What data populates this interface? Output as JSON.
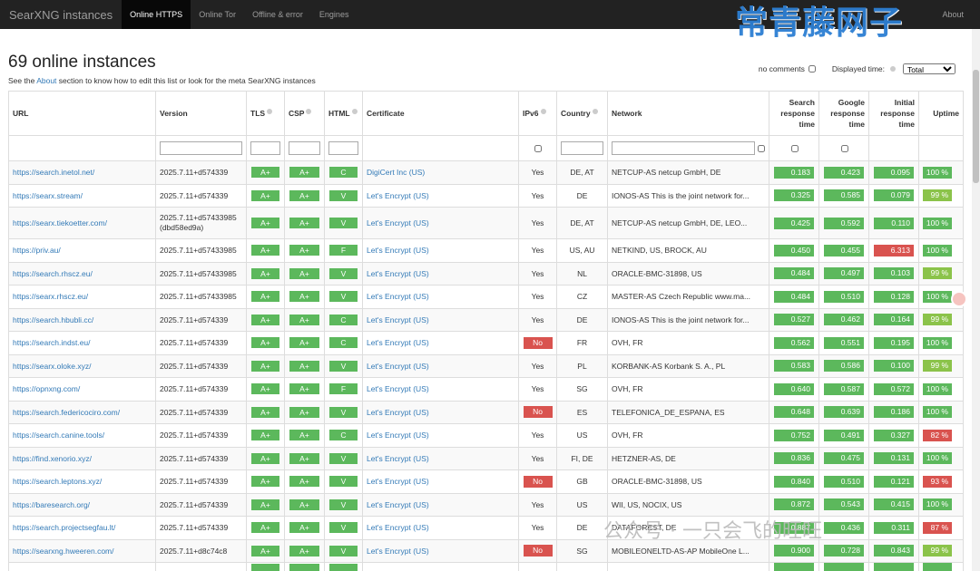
{
  "nav": {
    "brand": "SearXNG instances",
    "items": [
      "Online HTTPS",
      "Online Tor",
      "Offline & error",
      "Engines"
    ],
    "active": 0,
    "about": "About"
  },
  "watermark_top": "常青藤网子",
  "watermark_bottom": "公众号 · 一只会飞的旺旺",
  "controls": {
    "comments_label": "no comments",
    "displayed_time_label": "Displayed time:",
    "displayed_time_value": "Total"
  },
  "page": {
    "title": "69 online instances",
    "subtitle_prefix": "See the ",
    "subtitle_link": "About",
    "subtitle_suffix": " section to know how to edit this list or look for the meta SearXNG instances"
  },
  "columns": {
    "url": "URL",
    "version": "Version",
    "tls": "TLS",
    "csp": "CSP",
    "html": "HTML",
    "certificate": "Certificate",
    "ipv6": "IPv6",
    "country": "Country",
    "network": "Network",
    "search": [
      "Search",
      "response",
      "time"
    ],
    "google": [
      "Google",
      "response",
      "time"
    ],
    "initial": [
      "Initial",
      "response",
      "time"
    ],
    "uptime": "Uptime"
  },
  "rows": [
    {
      "url": "https://search.inetol.net/",
      "version": "2025.7.11+d574339",
      "tls": "A+",
      "csp": "A+",
      "html": "C",
      "cert": "DigiCert Inc (US)",
      "ipv6": "Yes",
      "country": "DE, AT",
      "network": "NETCUP-AS netcup GmbH, DE",
      "search": "0.183",
      "google": "0.423",
      "initial": "0.095",
      "initial_bad": false,
      "uptime": "100 %",
      "uptime_state": "ok"
    },
    {
      "url": "https://searx.stream/",
      "version": "2025.7.11+d574339",
      "tls": "A+",
      "csp": "A+",
      "html": "V",
      "cert": "Let's Encrypt (US)",
      "ipv6": "Yes",
      "country": "DE",
      "network": "IONOS-AS This is the joint network for...",
      "search": "0.325",
      "google": "0.585",
      "initial": "0.079",
      "initial_bad": false,
      "uptime": "99 %",
      "uptime_state": "warn"
    },
    {
      "url": "https://searx.tiekoetter.com/",
      "version": "2025.7.11+d57433985",
      "version2": "(dbd58ed9a)",
      "tls": "A+",
      "csp": "A+",
      "html": "V",
      "cert": "Let's Encrypt (US)",
      "ipv6": "Yes",
      "country": "DE, AT",
      "network": "NETCUP-AS netcup GmbH, DE, LEO...",
      "search": "0.425",
      "google": "0.592",
      "initial": "0.110",
      "initial_bad": false,
      "uptime": "100 %",
      "uptime_state": "ok"
    },
    {
      "url": "https://priv.au/",
      "version": "2025.7.11+d57433985",
      "tls": "A+",
      "csp": "A+",
      "html": "F",
      "cert": "Let's Encrypt (US)",
      "ipv6": "Yes",
      "country": "US, AU",
      "network": "NETKIND, US, BROCK, AU",
      "search": "0.450",
      "google": "0.455",
      "initial": "6.313",
      "initial_bad": true,
      "uptime": "100 %",
      "uptime_state": "ok"
    },
    {
      "url": "https://search.rhscz.eu/",
      "version": "2025.7.11+d57433985",
      "tls": "A+",
      "csp": "A+",
      "html": "V",
      "cert": "Let's Encrypt (US)",
      "ipv6": "Yes",
      "country": "NL",
      "network": "ORACLE-BMC-31898, US",
      "search": "0.484",
      "google": "0.497",
      "initial": "0.103",
      "initial_bad": false,
      "uptime": "99 %",
      "uptime_state": "warn"
    },
    {
      "url": "https://searx.rhscz.eu/",
      "version": "2025.7.11+d57433985",
      "tls": "A+",
      "csp": "A+",
      "html": "V",
      "cert": "Let's Encrypt (US)",
      "ipv6": "Yes",
      "country": "CZ",
      "network": "MASTER-AS Czech Republic www.ma...",
      "search": "0.484",
      "google": "0.510",
      "initial": "0.128",
      "initial_bad": false,
      "uptime": "100 %",
      "uptime_state": "ok"
    },
    {
      "url": "https://search.hbubli.cc/",
      "version": "2025.7.11+d574339",
      "tls": "A+",
      "csp": "A+",
      "html": "C",
      "cert": "Let's Encrypt (US)",
      "ipv6": "Yes",
      "country": "DE",
      "network": "IONOS-AS This is the joint network for...",
      "search": "0.527",
      "google": "0.462",
      "initial": "0.164",
      "initial_bad": false,
      "uptime": "99 %",
      "uptime_state": "warn"
    },
    {
      "url": "https://search.indst.eu/",
      "version": "2025.7.11+d574339",
      "tls": "A+",
      "csp": "A+",
      "html": "C",
      "cert": "Let's Encrypt (US)",
      "ipv6": "No",
      "country": "FR",
      "network": "OVH, FR",
      "search": "0.562",
      "google": "0.551",
      "initial": "0.195",
      "initial_bad": false,
      "uptime": "100 %",
      "uptime_state": "ok"
    },
    {
      "url": "https://searx.oloke.xyz/",
      "version": "2025.7.11+d574339",
      "tls": "A+",
      "csp": "A+",
      "html": "V",
      "cert": "Let's Encrypt (US)",
      "ipv6": "Yes",
      "country": "PL",
      "network": "KORBANK-AS Korbank S. A., PL",
      "search": "0.583",
      "google": "0.586",
      "initial": "0.100",
      "initial_bad": false,
      "uptime": "99 %",
      "uptime_state": "warn"
    },
    {
      "url": "https://opnxng.com/",
      "version": "2025.7.11+d574339",
      "tls": "A+",
      "csp": "A+",
      "html": "F",
      "cert": "Let's Encrypt (US)",
      "ipv6": "Yes",
      "country": "SG",
      "network": "OVH, FR",
      "search": "0.640",
      "google": "0.587",
      "initial": "0.572",
      "initial_bad": false,
      "uptime": "100 %",
      "uptime_state": "ok"
    },
    {
      "url": "https://search.federicociro.com/",
      "version": "2025.7.11+d574339",
      "tls": "A+",
      "csp": "A+",
      "html": "V",
      "cert": "Let's Encrypt (US)",
      "ipv6": "No",
      "country": "ES",
      "network": "TELEFONICA_DE_ESPANA, ES",
      "search": "0.648",
      "google": "0.639",
      "initial": "0.186",
      "initial_bad": false,
      "uptime": "100 %",
      "uptime_state": "ok"
    },
    {
      "url": "https://search.canine.tools/",
      "version": "2025.7.11+d574339",
      "tls": "A+",
      "csp": "A+",
      "html": "C",
      "cert": "Let's Encrypt (US)",
      "ipv6": "Yes",
      "country": "US",
      "network": "OVH, FR",
      "search": "0.752",
      "google": "0.491",
      "initial": "0.327",
      "initial_bad": false,
      "uptime": "82 %",
      "uptime_state": "bad"
    },
    {
      "url": "https://find.xenorio.xyz/",
      "version": "2025.7.11+d574339",
      "tls": "A+",
      "csp": "A+",
      "html": "V",
      "cert": "Let's Encrypt (US)",
      "ipv6": "Yes",
      "country": "FI, DE",
      "network": "HETZNER-AS, DE",
      "search": "0.836",
      "google": "0.475",
      "initial": "0.131",
      "initial_bad": false,
      "uptime": "100 %",
      "uptime_state": "ok"
    },
    {
      "url": "https://search.leptons.xyz/",
      "version": "2025.7.11+d574339",
      "tls": "A+",
      "csp": "A+",
      "html": "V",
      "cert": "Let's Encrypt (US)",
      "ipv6": "No",
      "country": "GB",
      "network": "ORACLE-BMC-31898, US",
      "search": "0.840",
      "google": "0.510",
      "initial": "0.121",
      "initial_bad": false,
      "uptime": "93 %",
      "uptime_state": "bad"
    },
    {
      "url": "https://baresearch.org/",
      "version": "2025.7.11+d574339",
      "tls": "A+",
      "csp": "A+",
      "html": "V",
      "cert": "Let's Encrypt (US)",
      "ipv6": "Yes",
      "country": "US",
      "network": "WII, US, NOCIX, US",
      "search": "0.872",
      "google": "0.543",
      "initial": "0.415",
      "initial_bad": false,
      "uptime": "100 %",
      "uptime_state": "ok"
    },
    {
      "url": "https://search.projectsegfau.lt/",
      "version": "2025.7.11+d574339",
      "tls": "A+",
      "csp": "A+",
      "html": "V",
      "cert": "Let's Encrypt (US)",
      "ipv6": "Yes",
      "country": "DE",
      "network": "DATAFOREST, DE",
      "search": "0.887",
      "google": "0.436",
      "initial": "0.311",
      "initial_bad": false,
      "uptime": "87 %",
      "uptime_state": "bad"
    },
    {
      "url": "https://searxng.hweeren.com/",
      "version": "2025.7.11+d8c74c8",
      "tls": "A+",
      "csp": "A+",
      "html": "V",
      "cert": "Let's Encrypt (US)",
      "ipv6": "No",
      "country": "SG",
      "network": "MOBILEONELTD-AS-AP MobileOne L...",
      "search": "0.900",
      "google": "0.728",
      "initial": "0.843",
      "initial_bad": false,
      "uptime": "99 %",
      "uptime_state": "warn"
    },
    {
      "url": "",
      "version": "",
      "tls": "",
      "csp": "",
      "html": "",
      "cert": "",
      "ipv6": "",
      "country": "",
      "network": "",
      "search": "",
      "google": "",
      "initial": "",
      "initial_bad": false,
      "uptime": "",
      "uptime_state": "ok"
    }
  ]
}
